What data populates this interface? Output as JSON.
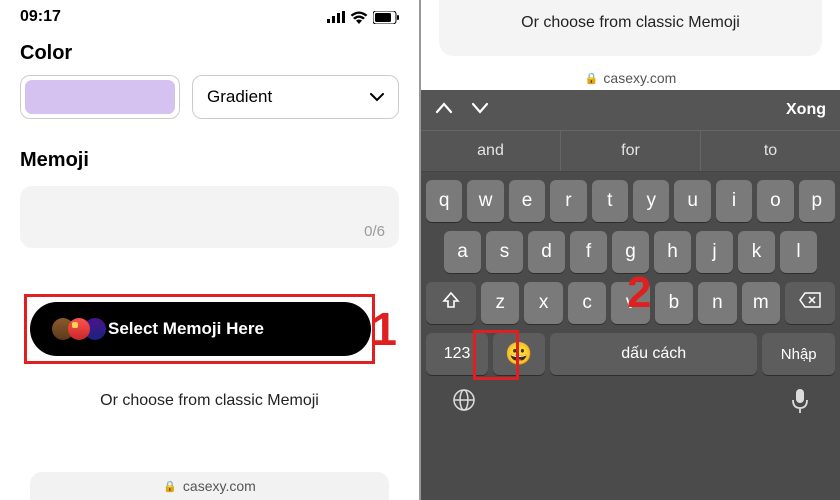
{
  "status": {
    "time": "09:17"
  },
  "color": {
    "label": "Color",
    "swatch_hex": "#d6c2f0",
    "dropdown_label": "Gradient"
  },
  "memoji": {
    "label": "Memoji",
    "counter": "0/6",
    "select_button": "Select Memoji Here",
    "classic_prompt": "Or choose from classic Memoji"
  },
  "url": "casexy.com",
  "annotations": {
    "step1": "1",
    "step2": "2"
  },
  "keyboard": {
    "done": "Xong",
    "suggestions": [
      "and",
      "for",
      "to"
    ],
    "row1": [
      "q",
      "w",
      "e",
      "r",
      "t",
      "y",
      "u",
      "i",
      "o",
      "p"
    ],
    "row2": [
      "a",
      "s",
      "d",
      "f",
      "g",
      "h",
      "j",
      "k",
      "l"
    ],
    "row3": [
      "z",
      "x",
      "c",
      "v",
      "b",
      "n",
      "m"
    ],
    "num_label": "123",
    "space_label": "dấu cách",
    "enter_label": "Nhập"
  }
}
